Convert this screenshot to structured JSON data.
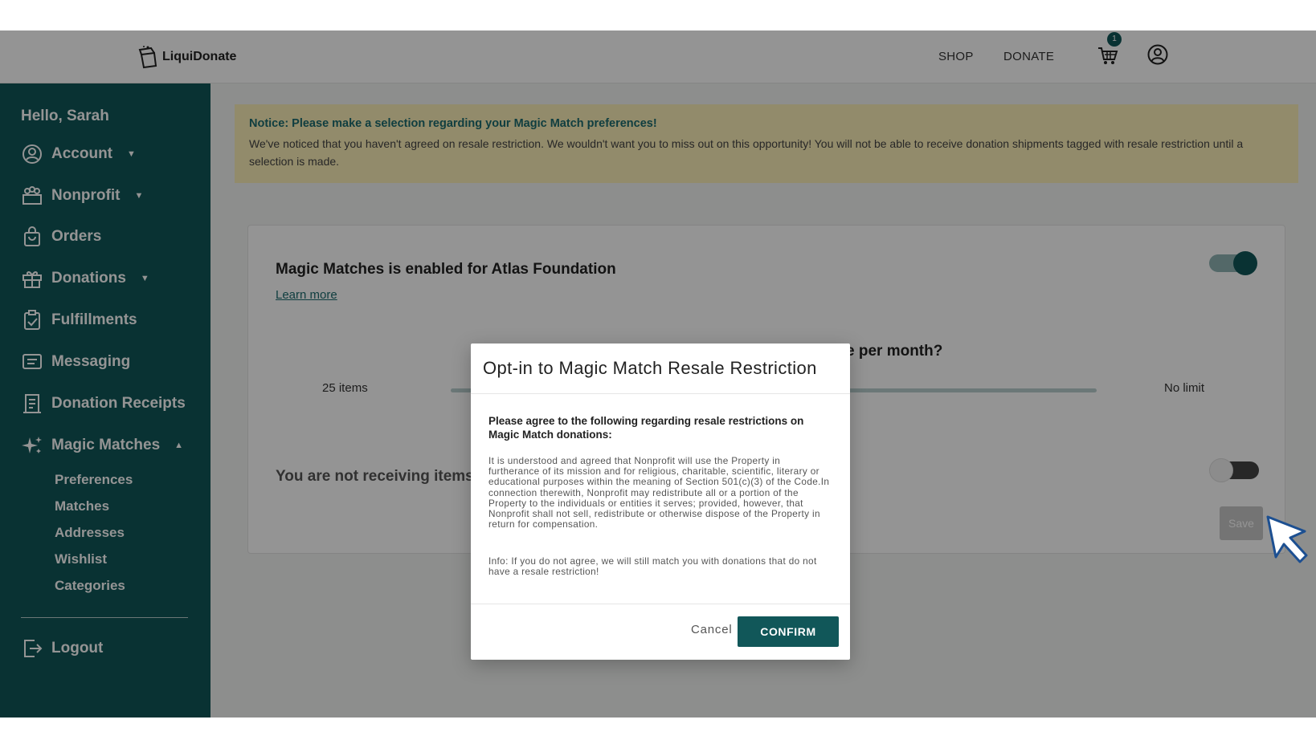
{
  "header": {
    "logo_text": "LiquiDonate",
    "nav": [
      "SHOP",
      "DONATE"
    ],
    "cart_count": "1"
  },
  "sidebar": {
    "greeting": "Hello, Sarah",
    "items": [
      {
        "label": "Account",
        "icon": "user-circle-icon"
      },
      {
        "label": "Nonprofit",
        "icon": "people-icon"
      },
      {
        "label": "Orders",
        "icon": "shopping-bag-icon"
      },
      {
        "label": "Donations",
        "icon": "gift-icon"
      },
      {
        "label": "Fulfillments",
        "icon": "clipboard-check-icon"
      },
      {
        "label": "Messaging",
        "icon": "message-icon"
      },
      {
        "label": "Donation Receipts",
        "icon": "receipt-icon"
      },
      {
        "label": "Magic Matches",
        "icon": "sparkles-icon"
      }
    ],
    "sub_items": [
      "Preferences",
      "Matches",
      "Addresses",
      "Wishlist",
      "Categories"
    ],
    "logout": "Logout"
  },
  "notice": {
    "title": "Notice: Please make a selection regarding your Magic Match preferences!",
    "body": "We've noticed that you haven't agreed on resale restriction. We wouldn't want you to miss out on this opportunity! You will not be able to receive donation shipments tagged with resale restriction until a selection is made."
  },
  "card": {
    "title": "Magic Matches is enabled for Atlas Foundation",
    "learn_more": "Learn more",
    "question_visible": "e per month?",
    "slider_min": "25 items",
    "slider_max": "No limit",
    "not_receiving": "You are not receiving items w",
    "save": "Save",
    "toggle_enabled": true,
    "toggle_resale": false
  },
  "modal": {
    "title": "Opt-in to Magic Match Resale Restriction",
    "intro": "Please agree to the following regarding resale restrictions on Magic Match donations:",
    "terms": "It is understood and agreed that Nonprofit will use the Property in furtherance of its mission and for religious, charitable, scientific, literary or educational purposes within the meaning of Section 501(c)(3) of the Code.In connection therewith, Nonprofit may redistribute all or a portion of the Property to the individuals or entities it serves; provided, however, that Nonprofit shall not sell, redistribute or otherwise dispose of the Property in return for compensation.",
    "info": "Info: If you do not agree, we will still match you with donations that do not have a resale restriction!",
    "cancel": "Cancel",
    "confirm": "CONFIRM"
  },
  "colors": {
    "primary": "#115759",
    "notice_bg": "#fcefb8",
    "notice_title": "#1c6b6e"
  }
}
